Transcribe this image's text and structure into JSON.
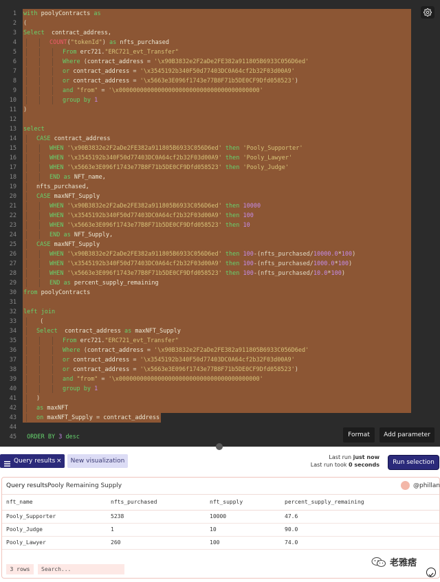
{
  "code": {
    "lines": [
      {
        "n": 1,
        "indent": 0,
        "tokens": [
          [
            "kw",
            "with "
          ],
          [
            "id",
            "poolyContracts "
          ],
          [
            "kw",
            "as"
          ]
        ]
      },
      {
        "n": 2,
        "indent": 0,
        "tokens": [
          [
            "op",
            "("
          ]
        ]
      },
      {
        "n": 3,
        "indent": 0,
        "tokens": [
          [
            "kw",
            "Select "
          ],
          [
            "id",
            " contract_address,"
          ]
        ]
      },
      {
        "n": 4,
        "indent": 2,
        "tokens": [
          [
            "fn",
            "COUNT"
          ],
          [
            "op",
            "("
          ],
          [
            "str",
            "\"tokenId\""
          ],
          [
            "op",
            ") "
          ],
          [
            "kw",
            "as "
          ],
          [
            "id",
            "nfts_purchased"
          ]
        ]
      },
      {
        "n": 5,
        "indent": 3,
        "tokens": [
          [
            "kw",
            "From "
          ],
          [
            "id",
            "erc721."
          ],
          [
            "str",
            "\"ERC721_evt_Transfer\""
          ]
        ]
      },
      {
        "n": 6,
        "indent": 3,
        "tokens": [
          [
            "kw",
            "Where "
          ],
          [
            "op",
            "("
          ],
          [
            "id",
            "contract_address "
          ],
          [
            "op",
            "= "
          ],
          [
            "str",
            "'\\x90B3832e2F2aDe2FE382a911805B6933C056D6ed'"
          ]
        ]
      },
      {
        "n": 7,
        "indent": 3,
        "tokens": [
          [
            "kw",
            "or "
          ],
          [
            "id",
            "contract_address "
          ],
          [
            "op",
            "= "
          ],
          [
            "str",
            "'\\x3545192b340F50d77403DC0A64cf2b32F03d00A9'"
          ]
        ]
      },
      {
        "n": 8,
        "indent": 3,
        "tokens": [
          [
            "kw",
            "or "
          ],
          [
            "id",
            "contract_address "
          ],
          [
            "op",
            "= "
          ],
          [
            "str",
            "'\\x5663e3E096f1743e77B8F71b5DE0CF9Dfd058523'"
          ],
          [
            "op",
            ")"
          ]
        ]
      },
      {
        "n": 9,
        "indent": 3,
        "tokens": [
          [
            "kw",
            "and "
          ],
          [
            "str",
            "\"from\" "
          ],
          [
            "op",
            "= "
          ],
          [
            "str",
            "'\\x0000000000000000000000000000000000000000'"
          ]
        ]
      },
      {
        "n": 10,
        "indent": 3,
        "tokens": [
          [
            "kw",
            "group by "
          ],
          [
            "num",
            "1"
          ]
        ]
      },
      {
        "n": 11,
        "indent": 0,
        "tokens": [
          [
            "op",
            ")"
          ]
        ]
      },
      {
        "n": 12,
        "indent": 0,
        "tokens": []
      },
      {
        "n": 13,
        "indent": 0,
        "tokens": [
          [
            "kw",
            "select"
          ]
        ]
      },
      {
        "n": 14,
        "indent": 1,
        "tokens": [
          [
            "kw",
            "CASE "
          ],
          [
            "id",
            "contract_address"
          ]
        ]
      },
      {
        "n": 15,
        "indent": 2,
        "tokens": [
          [
            "kw",
            "WHEN "
          ],
          [
            "str",
            "'\\x90B3832e2F2aDe2FE382a911805B6933C056D6ed' "
          ],
          [
            "kw",
            "then "
          ],
          [
            "str",
            "'Pooly_Supporter'"
          ]
        ]
      },
      {
        "n": 16,
        "indent": 2,
        "tokens": [
          [
            "kw",
            "WHEN "
          ],
          [
            "str",
            "'\\x3545192b340F50d77403DC0A64cf2b32F03d00A9' "
          ],
          [
            "kw",
            "then "
          ],
          [
            "str",
            "'Pooly_Lawyer'"
          ]
        ]
      },
      {
        "n": 17,
        "indent": 2,
        "tokens": [
          [
            "kw",
            "WHEN "
          ],
          [
            "str",
            "'\\x5663e3E096f1743e77B8F71b5DE0CF9Dfd058523' "
          ],
          [
            "kw",
            "then "
          ],
          [
            "str",
            "'Pooly_Judge'"
          ]
        ]
      },
      {
        "n": 18,
        "indent": 2,
        "tokens": [
          [
            "kw",
            "END "
          ],
          [
            "kw",
            "as "
          ],
          [
            "id",
            "NFT_name,"
          ]
        ]
      },
      {
        "n": 19,
        "indent": 1,
        "tokens": [
          [
            "id",
            "nfts_purchased,"
          ]
        ]
      },
      {
        "n": 20,
        "indent": 1,
        "tokens": [
          [
            "kw",
            "CASE "
          ],
          [
            "id",
            "maxNFT_Supply"
          ]
        ]
      },
      {
        "n": 21,
        "indent": 2,
        "tokens": [
          [
            "kw",
            "WHEN "
          ],
          [
            "str",
            "'\\x90B3832e2F2aDe2FE382a911805B6933C056D6ed' "
          ],
          [
            "kw",
            "then "
          ],
          [
            "num",
            "10000"
          ]
        ]
      },
      {
        "n": 22,
        "indent": 2,
        "tokens": [
          [
            "kw",
            "WHEN "
          ],
          [
            "str",
            "'\\x3545192b340F50d77403DC0A64cf2b32F03d00A9' "
          ],
          [
            "kw",
            "then "
          ],
          [
            "num",
            "100"
          ]
        ]
      },
      {
        "n": 23,
        "indent": 2,
        "tokens": [
          [
            "kw",
            "WHEN "
          ],
          [
            "str",
            "'\\x5663e3E096f1743e77B8F71b5DE0CF9Dfd058523' "
          ],
          [
            "kw",
            "then "
          ],
          [
            "num",
            "10"
          ]
        ]
      },
      {
        "n": 24,
        "indent": 2,
        "tokens": [
          [
            "kw",
            "END "
          ],
          [
            "kw",
            "as "
          ],
          [
            "id",
            "NFT_Supply,"
          ]
        ]
      },
      {
        "n": 25,
        "indent": 1,
        "tokens": [
          [
            "kw",
            "CASE "
          ],
          [
            "id",
            "maxNFT_Supply"
          ]
        ]
      },
      {
        "n": 26,
        "indent": 2,
        "tokens": [
          [
            "kw",
            "WHEN "
          ],
          [
            "str",
            "'\\x90B3832e2F2aDe2FE382a911805B6933C056D6ed' "
          ],
          [
            "kw",
            "then "
          ],
          [
            "num",
            "100"
          ],
          [
            "op",
            "-(nfts_purchased/"
          ],
          [
            "num",
            "10000.0"
          ],
          [
            "op",
            "*"
          ],
          [
            "num",
            "100"
          ],
          [
            "op",
            ")"
          ]
        ]
      },
      {
        "n": 27,
        "indent": 2,
        "tokens": [
          [
            "kw",
            "WHEN "
          ],
          [
            "str",
            "'\\x3545192b340F50d77403DC0A64cf2b32F03d00A9' "
          ],
          [
            "kw",
            "then "
          ],
          [
            "num",
            "100"
          ],
          [
            "op",
            "-(nfts_purchased/"
          ],
          [
            "num",
            "1000.0"
          ],
          [
            "op",
            "*"
          ],
          [
            "num",
            "100"
          ],
          [
            "op",
            ")"
          ]
        ]
      },
      {
        "n": 28,
        "indent": 2,
        "tokens": [
          [
            "kw",
            "WHEN "
          ],
          [
            "str",
            "'\\x5663e3E096f1743e77B8F71b5DE0CF9Dfd058523' "
          ],
          [
            "kw",
            "then "
          ],
          [
            "num",
            "100"
          ],
          [
            "op",
            "-(nfts_purchased/"
          ],
          [
            "num",
            "10.0"
          ],
          [
            "op",
            "*"
          ],
          [
            "num",
            "100"
          ],
          [
            "op",
            ")"
          ]
        ]
      },
      {
        "n": 29,
        "indent": 2,
        "tokens": [
          [
            "kw",
            "END "
          ],
          [
            "kw",
            "as "
          ],
          [
            "id",
            "percent_supply_remaining"
          ]
        ]
      },
      {
        "n": 30,
        "indent": 0,
        "tokens": [
          [
            "kw",
            "from "
          ],
          [
            "id",
            "poolyContracts"
          ]
        ]
      },
      {
        "n": 31,
        "indent": 0,
        "tokens": []
      },
      {
        "n": 32,
        "indent": 0,
        "tokens": [
          [
            "kw",
            "left join"
          ]
        ]
      },
      {
        "n": 33,
        "indent": 1,
        "tokens": [
          [
            "op",
            " ("
          ]
        ]
      },
      {
        "n": 34,
        "indent": 1,
        "tokens": [
          [
            "kw",
            "Select "
          ],
          [
            "id",
            " contract_address "
          ],
          [
            "kw",
            "as "
          ],
          [
            "id",
            "maxNFT_Supply"
          ]
        ]
      },
      {
        "n": 35,
        "indent": 3,
        "tokens": [
          [
            "kw",
            "From "
          ],
          [
            "id",
            "erc721."
          ],
          [
            "str",
            "\"ERC721_evt_Transfer\""
          ]
        ]
      },
      {
        "n": 36,
        "indent": 3,
        "tokens": [
          [
            "kw",
            "Where "
          ],
          [
            "op",
            "("
          ],
          [
            "id",
            "contract_address "
          ],
          [
            "op",
            "= "
          ],
          [
            "str",
            "'\\x90B3832e2F2aDe2FE382a911805B6933C056D6ed'"
          ]
        ]
      },
      {
        "n": 37,
        "indent": 3,
        "tokens": [
          [
            "kw",
            "or "
          ],
          [
            "id",
            "contract_address "
          ],
          [
            "op",
            "= "
          ],
          [
            "str",
            "'\\x3545192b340F50d77403DC0A64cf2b32F03d00A9'"
          ]
        ]
      },
      {
        "n": 38,
        "indent": 3,
        "tokens": [
          [
            "kw",
            "or "
          ],
          [
            "id",
            "contract_address "
          ],
          [
            "op",
            "= "
          ],
          [
            "str",
            "'\\x5663e3E096f1743e77B8F71b5DE0CF9Dfd058523'"
          ],
          [
            "op",
            ")"
          ]
        ]
      },
      {
        "n": 39,
        "indent": 3,
        "tokens": [
          [
            "kw",
            "and "
          ],
          [
            "str",
            "\"from\" "
          ],
          [
            "op",
            "= "
          ],
          [
            "str",
            "'\\x0000000000000000000000000000000000000000'"
          ]
        ]
      },
      {
        "n": 40,
        "indent": 3,
        "tokens": [
          [
            "kw",
            "group by "
          ],
          [
            "num",
            "1"
          ]
        ]
      },
      {
        "n": 41,
        "indent": 1,
        "tokens": [
          [
            "op",
            ")"
          ]
        ]
      },
      {
        "n": 42,
        "indent": 1,
        "tokens": [
          [
            "kw",
            "as "
          ],
          [
            "id",
            "maxNFT"
          ]
        ]
      },
      {
        "n": 43,
        "indent": 1,
        "tokens": [
          [
            "kw",
            "on "
          ],
          [
            "id",
            "maxNFT_Supply "
          ],
          [
            "op",
            "= "
          ],
          [
            "id",
            "contract_address"
          ]
        ]
      },
      {
        "n": 44,
        "indent": 0,
        "tokens": []
      },
      {
        "n": 45,
        "indent": 0,
        "tokens": [
          [
            "kw",
            " ORDER BY "
          ],
          [
            "num",
            "3 "
          ],
          [
            "kw",
            "desc"
          ]
        ]
      }
    ],
    "selected_through_line": 43
  },
  "toolbar": {
    "format_label": "Format",
    "add_parameter_label": "Add parameter",
    "settings_icon": "gear-icon"
  },
  "tabs": {
    "query_results_label": "Query results",
    "new_visualization_label": "New visualization"
  },
  "run": {
    "last_run_prefix": "Last run",
    "last_run_value": "just now",
    "took_prefix": "Last run took",
    "took_value": "0 seconds",
    "button_label": "Run selection"
  },
  "results": {
    "label": "Query results",
    "title": "Pooly Remaining Supply",
    "user": "@phillan",
    "columns": [
      "nft_name",
      "nfts_purchased",
      "nft_supply",
      "percent_supply_remaining"
    ],
    "rows": [
      [
        "Pooly_Supporter",
        "5238",
        "10000",
        "47.6"
      ],
      [
        "Pooly_Judge",
        "1",
        "10",
        "90.0"
      ],
      [
        "Pooly_Lawyer",
        "260",
        "100",
        "74.0"
      ]
    ],
    "row_count": "3 rows",
    "search_placeholder": "Search..."
  },
  "watermark": {
    "text": "老雅痞"
  },
  "colors": {
    "selection": "#8c5634",
    "editor_bg": "#2b2b2b",
    "accent": "#2b2a7a",
    "results_border": "#f0c4bd"
  }
}
